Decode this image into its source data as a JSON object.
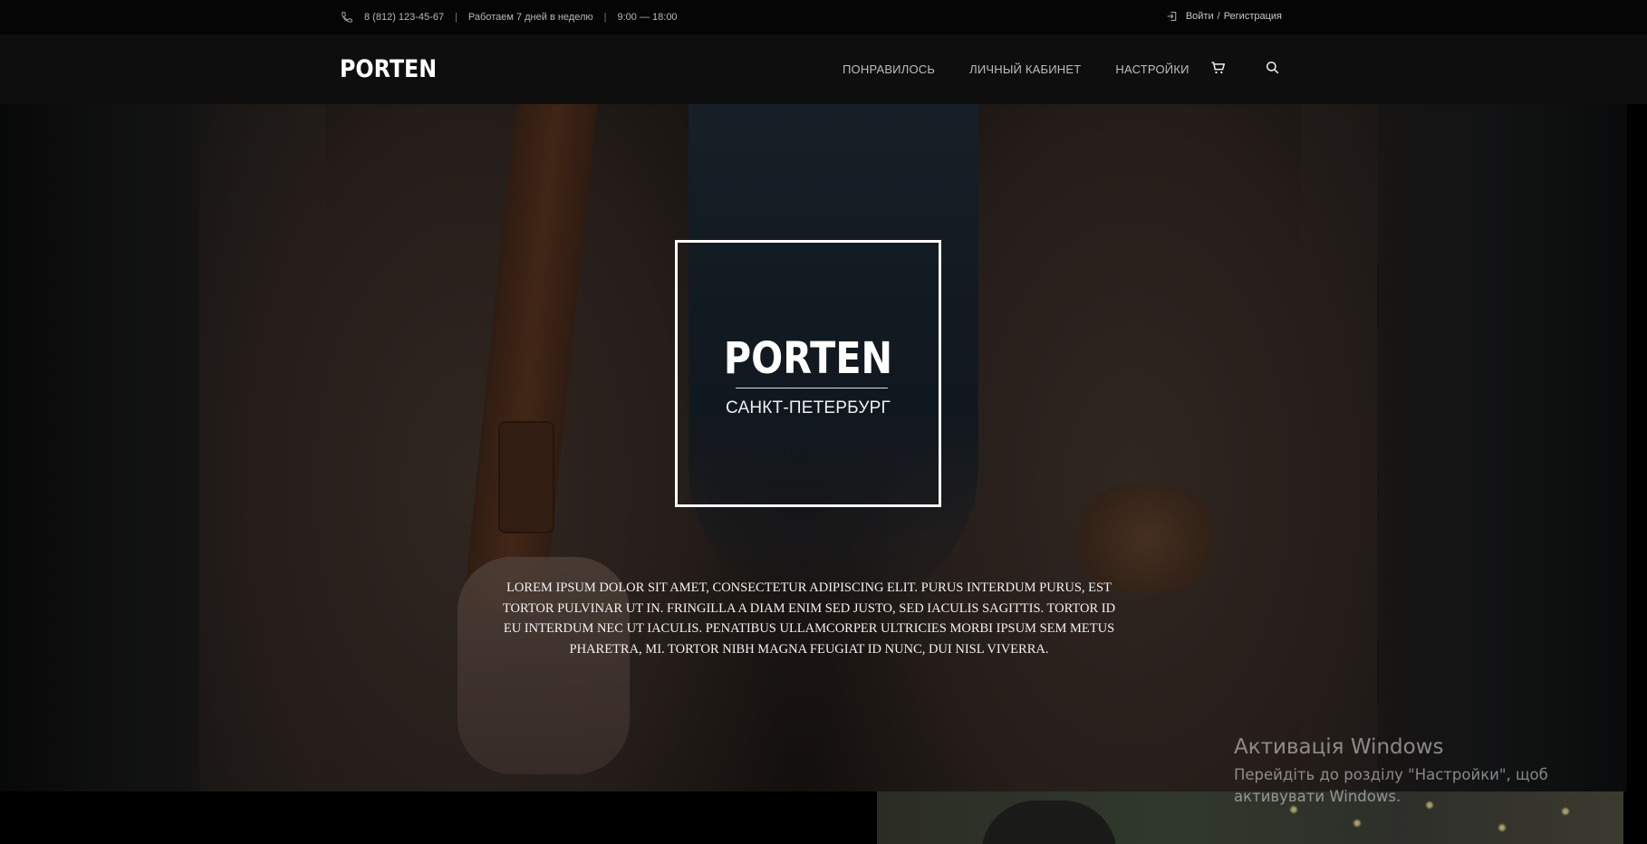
{
  "topbar": {
    "phone": "8 (812) 123-45-67",
    "separator": "|",
    "hours_text": "Работаем 7 дней в неделю",
    "hours": "9:00 — 18:00",
    "login": "Войти",
    "slash": "/",
    "register": "Регистрация"
  },
  "header": {
    "logo": "PORTEN",
    "nav": [
      "ПОНРАВИЛОСЬ",
      "ЛИЧНЫЙ КАБИНЕТ",
      "НАСТРОЙКИ"
    ],
    "icons": [
      "cart-icon",
      "search-icon"
    ]
  },
  "hero": {
    "logo": "PORTEN",
    "city": "САНКТ-ПЕТЕРБУРГ",
    "text": "LOREM IPSUM DOLOR SIT AMET, CONSECTETUR ADIPISCING ELIT. PURUS INTERDUM PURUS, EST TORTOR PULVINAR UT IN. FRINGILLA A DIAM ENIM SED JUSTO, SED IACULIS SAGITTIS. TORTOR ID EU INTERDUM NEC UT IACULIS. PENATIBUS ULLAMCORPER ULTRICIES MORBI IPSUM SEM METUS PHARETRA, MI. TORTOR NIBH MAGNA FEUGIAT ID NUNC, DUI NISL VIVERRA."
  },
  "watermark": {
    "title": "Активація Windows",
    "description": "Перейдіть до розділу \"Настройки\", щоб активувати Windows."
  },
  "colors": {
    "topbar_bg": "#050505",
    "header_bg": "#0e0e0e",
    "text_light": "#bdbdbd"
  }
}
